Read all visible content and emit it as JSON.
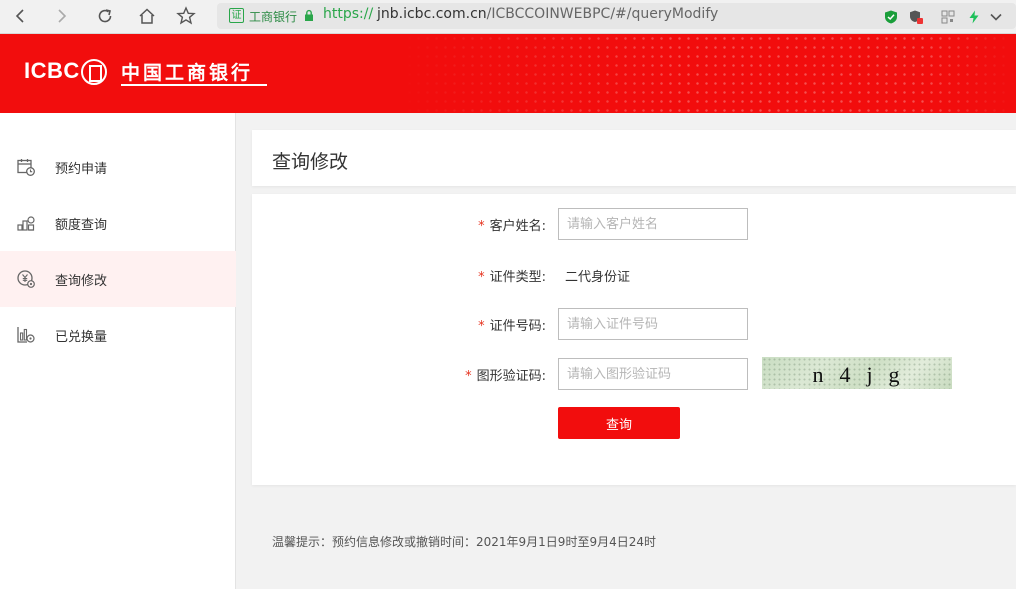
{
  "browser": {
    "url_site_label": "工商银行",
    "url_scheme": "https://",
    "url_host": "jnb.icbc.com.cn",
    "url_path": "/ICBCCOINWEBPC/#/queryModify"
  },
  "banner": {
    "logo_en": "ICBC",
    "logo_cn": "中国工商银行"
  },
  "sidebar": {
    "items": [
      {
        "label": "预约申请",
        "icon": "calendar-clock-icon"
      },
      {
        "label": "额度查询",
        "icon": "coin-stack-search-icon"
      },
      {
        "label": "查询修改",
        "icon": "yuan-coin-gear-icon",
        "active": true
      },
      {
        "label": "已兑换量",
        "icon": "chart-gear-icon"
      }
    ]
  },
  "page": {
    "title": "查询修改"
  },
  "form": {
    "required_mark": "*",
    "name": {
      "label": "客户姓名:",
      "placeholder": "请输入客户姓名",
      "value": ""
    },
    "id_type": {
      "label": "证件类型:",
      "value": "二代身份证"
    },
    "id_number": {
      "label": "证件号码:",
      "placeholder": "请输入证件号码",
      "value": ""
    },
    "captcha": {
      "label": "图形验证码:",
      "placeholder": "请输入图形验证码",
      "value": "",
      "image_text": "n4jg"
    },
    "submit_label": "查询"
  },
  "footer": {
    "tip": "温馨提示：预约信息修改或撤销时间：2021年9月1日9时至9月4日24时"
  },
  "colors": {
    "brand_red": "#f20d0d",
    "required_red": "#e6321e",
    "active_bg": "#fff1f1"
  }
}
